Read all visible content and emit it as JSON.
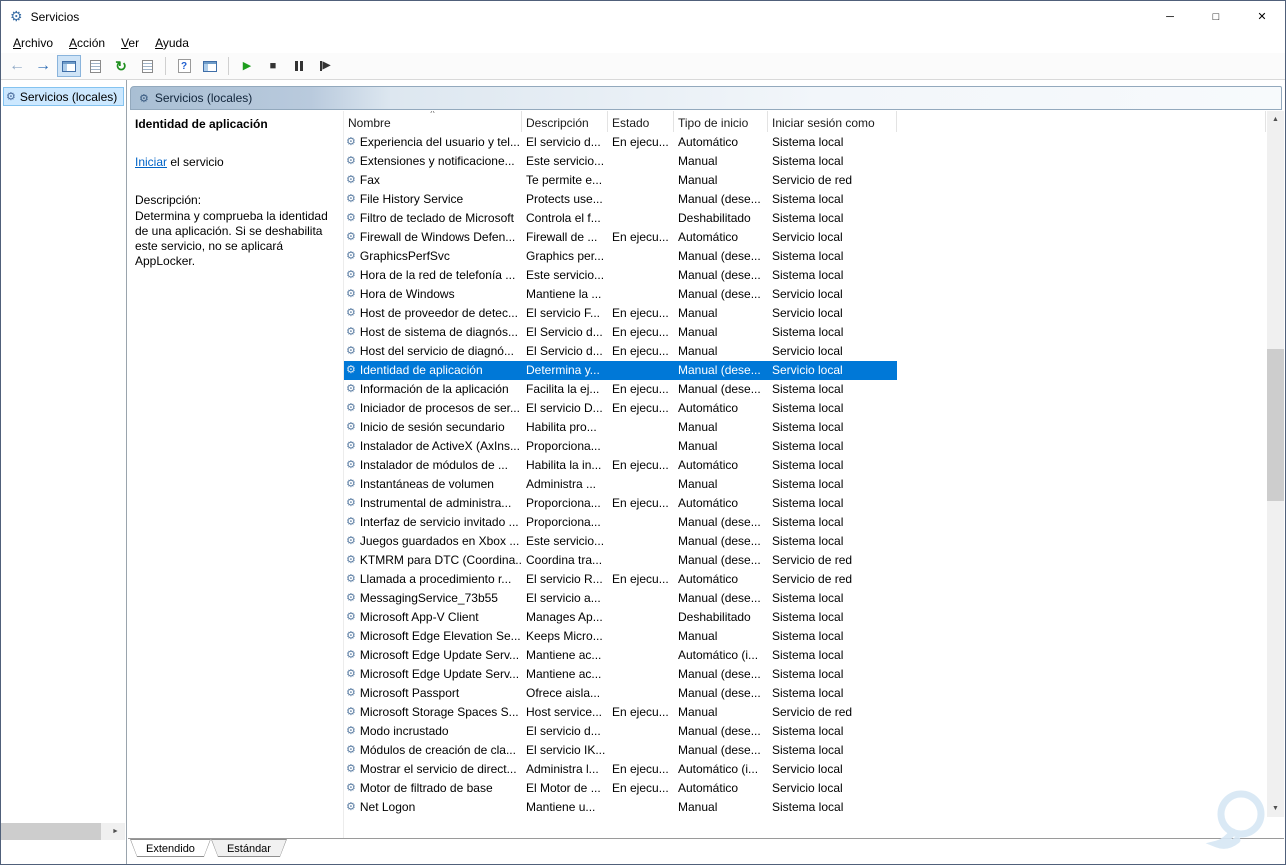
{
  "window": {
    "title": "Servicios"
  },
  "window_controls": {
    "minimize": "─",
    "maximize": "□",
    "close": "✕"
  },
  "icons": {
    "app_glyph": "⚙",
    "service_glyph": "⚙",
    "tree_glyph": "⚙",
    "header_glyph": "⚙",
    "back": "←",
    "forward": "→",
    "refresh": "↻",
    "help": "?",
    "start": "▶",
    "stop": "■",
    "step": "▶",
    "scroll_up": "▲",
    "scroll_down": "▼",
    "scroll_right": "►",
    "sort_asc": "^"
  },
  "menubar": {
    "items": [
      "Archivo",
      "Acción",
      "Ver",
      "Ayuda"
    ]
  },
  "toolbar_icon_names": [
    "back",
    "forward",
    "show-hide-console-tree",
    "properties",
    "refresh",
    "export-list",
    "help",
    "extended-view",
    "start-service",
    "stop-service",
    "pause-service",
    "restart-service"
  ],
  "tree": {
    "root_label": "Servicios (locales)"
  },
  "content_header": {
    "label": "Servicios (locales)"
  },
  "detail": {
    "service_title": "Identidad de aplicación",
    "action_link": "Iniciar",
    "action_rest": " el servicio",
    "description_label": "Descripción:",
    "description": "Determina y comprueba la identidad de una aplicación. Si se deshabilita este servicio, no se aplicará AppLocker."
  },
  "table": {
    "columns": [
      "Nombre",
      "Descripción",
      "Estado",
      "Tipo de inicio",
      "Iniciar sesión como"
    ],
    "sort": {
      "column": "Nombre",
      "direction": "asc"
    },
    "selected_index": 12,
    "rows": [
      {
        "name": "Experiencia del usuario y tel...",
        "desc": "El servicio d...",
        "estado": "En ejecu...",
        "tipo": "Automático",
        "sesion": "Sistema local"
      },
      {
        "name": "Extensiones y notificacione...",
        "desc": "Este servicio...",
        "estado": "",
        "tipo": "Manual",
        "sesion": "Sistema local"
      },
      {
        "name": "Fax",
        "desc": "Te permite e...",
        "estado": "",
        "tipo": "Manual",
        "sesion": "Servicio de red"
      },
      {
        "name": "File History Service",
        "desc": "Protects use...",
        "estado": "",
        "tipo": "Manual (dese...",
        "sesion": "Sistema local"
      },
      {
        "name": "Filtro de teclado de Microsoft",
        "desc": "Controla el f...",
        "estado": "",
        "tipo": "Deshabilitado",
        "sesion": "Sistema local"
      },
      {
        "name": "Firewall de Windows Defen...",
        "desc": "Firewall de ...",
        "estado": "En ejecu...",
        "tipo": "Automático",
        "sesion": "Servicio local"
      },
      {
        "name": "GraphicsPerfSvc",
        "desc": "Graphics per...",
        "estado": "",
        "tipo": "Manual (dese...",
        "sesion": "Sistema local"
      },
      {
        "name": "Hora de la red de telefonía ...",
        "desc": "Este servicio...",
        "estado": "",
        "tipo": "Manual (dese...",
        "sesion": "Sistema local"
      },
      {
        "name": "Hora de Windows",
        "desc": "Mantiene la ...",
        "estado": "",
        "tipo": "Manual (dese...",
        "sesion": "Servicio local"
      },
      {
        "name": "Host de proveedor de detec...",
        "desc": "El servicio F...",
        "estado": "En ejecu...",
        "tipo": "Manual",
        "sesion": "Servicio local"
      },
      {
        "name": "Host de sistema de diagnós...",
        "desc": "El Servicio d...",
        "estado": "En ejecu...",
        "tipo": "Manual",
        "sesion": "Sistema local"
      },
      {
        "name": "Host del servicio de diagnó...",
        "desc": "El Servicio d...",
        "estado": "En ejecu...",
        "tipo": "Manual",
        "sesion": "Servicio local"
      },
      {
        "name": "Identidad de aplicación",
        "desc": "Determina y...",
        "estado": "",
        "tipo": "Manual (dese...",
        "sesion": "Servicio local"
      },
      {
        "name": "Información de la aplicación",
        "desc": "Facilita la ej...",
        "estado": "En ejecu...",
        "tipo": "Manual (dese...",
        "sesion": "Sistema local"
      },
      {
        "name": "Iniciador de procesos de ser...",
        "desc": "El servicio D...",
        "estado": "En ejecu...",
        "tipo": "Automático",
        "sesion": "Sistema local"
      },
      {
        "name": "Inicio de sesión secundario",
        "desc": "Habilita pro...",
        "estado": "",
        "tipo": "Manual",
        "sesion": "Sistema local"
      },
      {
        "name": "Instalador de ActiveX (AxIns...",
        "desc": "Proporciona...",
        "estado": "",
        "tipo": "Manual",
        "sesion": "Sistema local"
      },
      {
        "name": "Instalador de módulos de ...",
        "desc": "Habilita la in...",
        "estado": "En ejecu...",
        "tipo": "Automático",
        "sesion": "Sistema local"
      },
      {
        "name": "Instantáneas de volumen",
        "desc": "Administra ...",
        "estado": "",
        "tipo": "Manual",
        "sesion": "Sistema local"
      },
      {
        "name": "Instrumental de administra...",
        "desc": "Proporciona...",
        "estado": "En ejecu...",
        "tipo": "Automático",
        "sesion": "Sistema local"
      },
      {
        "name": "Interfaz de servicio invitado ...",
        "desc": "Proporciona...",
        "estado": "",
        "tipo": "Manual (dese...",
        "sesion": "Sistema local"
      },
      {
        "name": "Juegos guardados en Xbox ...",
        "desc": "Este servicio...",
        "estado": "",
        "tipo": "Manual (dese...",
        "sesion": "Sistema local"
      },
      {
        "name": "KTMRM para DTC (Coordina...",
        "desc": "Coordina tra...",
        "estado": "",
        "tipo": "Manual (dese...",
        "sesion": "Servicio de red"
      },
      {
        "name": "Llamada a procedimiento r...",
        "desc": "El servicio R...",
        "estado": "En ejecu...",
        "tipo": "Automático",
        "sesion": "Servicio de red"
      },
      {
        "name": "MessagingService_73b55",
        "desc": "El servicio a...",
        "estado": "",
        "tipo": "Manual (dese...",
        "sesion": "Sistema local"
      },
      {
        "name": "Microsoft App-V Client",
        "desc": "Manages Ap...",
        "estado": "",
        "tipo": "Deshabilitado",
        "sesion": "Sistema local"
      },
      {
        "name": "Microsoft Edge Elevation Se...",
        "desc": "Keeps Micro...",
        "estado": "",
        "tipo": "Manual",
        "sesion": "Sistema local"
      },
      {
        "name": "Microsoft Edge Update Serv...",
        "desc": "Mantiene ac...",
        "estado": "",
        "tipo": "Automático (i...",
        "sesion": "Sistema local"
      },
      {
        "name": "Microsoft Edge Update Serv...",
        "desc": "Mantiene ac...",
        "estado": "",
        "tipo": "Manual (dese...",
        "sesion": "Sistema local"
      },
      {
        "name": "Microsoft Passport",
        "desc": "Ofrece aisla...",
        "estado": "",
        "tipo": "Manual (dese...",
        "sesion": "Sistema local"
      },
      {
        "name": "Microsoft Storage Spaces S...",
        "desc": "Host service...",
        "estado": "En ejecu...",
        "tipo": "Manual",
        "sesion": "Servicio de red"
      },
      {
        "name": "Modo incrustado",
        "desc": "El servicio d...",
        "estado": "",
        "tipo": "Manual (dese...",
        "sesion": "Sistema local"
      },
      {
        "name": "Módulos de creación de cla...",
        "desc": "El servicio IK...",
        "estado": "",
        "tipo": "Manual (dese...",
        "sesion": "Sistema local"
      },
      {
        "name": "Mostrar el servicio de direct...",
        "desc": "Administra l...",
        "estado": "En ejecu...",
        "tipo": "Automático (i...",
        "sesion": "Servicio local"
      },
      {
        "name": "Motor de filtrado de base",
        "desc": "El Motor de ...",
        "estado": "En ejecu...",
        "tipo": "Automático",
        "sesion": "Servicio local"
      },
      {
        "name": "Net Logon",
        "desc": "Mantiene u...",
        "estado": "",
        "tipo": "Manual",
        "sesion": "Sistema local"
      }
    ]
  },
  "tabs": {
    "items": [
      "Extendido",
      "Estándar"
    ],
    "active_index": 0
  }
}
